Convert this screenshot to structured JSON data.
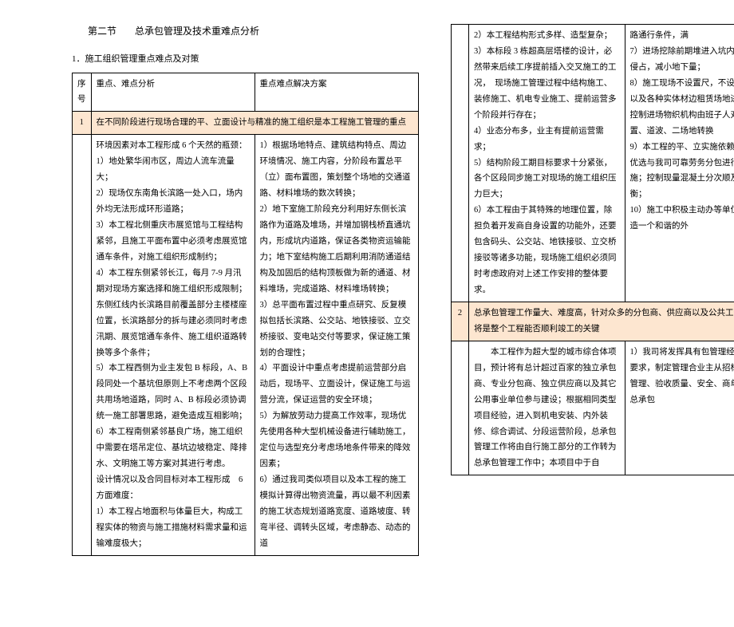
{
  "section": {
    "label": "第二节",
    "title": "总承包管理及技术重难点分析"
  },
  "subsection1": "1．施工组织管理重点难点及对策",
  "table": {
    "headers": {
      "num": "序号",
      "col1": "重点、难点分析",
      "col2": "重点难点解决方案"
    },
    "row1": {
      "num": "1",
      "span_text": "在不同阶段进行现场合理的平、立面设计与精准的施工组织是本工程施工管理的重点"
    },
    "row1_content": {
      "left_intro": "环境因素对本工程形成 6 个天然的瓶颈：",
      "left_items": [
        "1）地处繁华闹市区，周边人流车流量大；",
        "2）现场仅东南角长滨路一处入口，场内外均无法形成环形道路；",
        "3）本工程北侧重庆市展览馆与工程结构紧邻，且施工平面布置中必须考虑展览馆通车条件，对施工组织形成制约；",
        "4）本工程东侧紧邻长江，每月 7-9 月汛期对现场方案选择和施工组织形成限制；东侧红线内长滨路目前覆盖部分主楼楼座位置，长滨路部分的拆与建必须同时考虑汛期、展览馆通车条件、施工组织道路转换等多个条件；",
        "5）本工程西侧为业主发包 B 标段，A、B 段同处一个基坑但原则上不考虑两个区段共用场地道路，同时 A、B 标段必须协调统一施工部署思路，避免造成互相影响；",
        "6）本工程南侧紧邻基良广场，施工组织中需要在塔吊定位、基坑边坡稳定、降排水、文明施工等方案对其进行考虑。"
      ],
      "left_design": "设计情况以及合同目标对本工程形成　6 方面难度：",
      "left_design_items": [
        "1）本工程占地面积与体量巨大，构成工程实体的物资与施工措施材料需求量和运输难度极大；"
      ],
      "right_items": [
        "1）根据场地特点、建筑结构特点、周边环境情况、施工内容，分阶段布置总平（立）面布置图，策划整个场地的交通道路、材料堆场的数次转换；",
        "2）地下室施工阶段充分利用好东侧长滨路作为道路及堆场，并增加钢栈桥直通坑内，形成坑内道路，保证各类物资运输能力；地下室结构施工后期利用消防通道结构及加固后的结构顶板做为新的通道、材料堆场，完成道路、材料堆场转换；",
        "3）总平面布置过程中重点研究、反复模拟包括长滨路、公交站、地铁接驳、立交桥接驳、变电站交付等要求，保证施工策划的合理性；",
        "4）平面设计中重点考虑提前运营部分启动后，现场平、立面设计，保证施工与运营分流，保证运营的安全环境；",
        "5）为解放劳动力提高工作效率，现场优先使用各种大型机械设备进行辅助施工，定位与选型充分考虑场地条件带来的降效因素；",
        "6）通过我司类似项目以及本工程的施工模拟计算得出物资流量，再以最不利因素的施工状态规划道路宽度、道路坡度、转弯半径、调转头区域，考虑静态、动态的道"
      ]
    },
    "page2_left_items": [
      "2）本工程结构形式多样、造型复杂；",
      "3）本标段 3 栋超高层塔楼的设计，必然带来后续工序提前插入交叉施工的工况，　现场施工管理过程中结构施工、装修施工、机电专业施工、提前运营多个阶段并行存在；",
      "4）业态分布多，业主有提前运营需求；",
      "5）结构阶段工期目标要求十分紧张，各个区段同步施工对现场的施工组织压力巨大；",
      "6）本工程由于其特殊的地理位置，除担负着开发商自身设置的功能外，还要包含码头、公交站、地铁接驳、立交桥接驳等诸多功能，现场施工组织必须同时考虑政府对上述工作安排的整体要求。"
    ],
    "page2_right_items": [
      "路通行条件，满",
      "7）进场挖除前期堆进入坑内，避免侵占，减小地下量；",
      "8）施工现场不设置尺，不设置大型以及各种实体材边租赁场地进行严格控制进场物织机构由班子人对场地设置、道波、二场地转换",
      "9）本工程的平、立实施依赖于施工优选与我司可靠劳务分包进行配的实施；控制现量混凝土分次顺及运输均衡；",
      "10）施工中积极主动办等单位联系，造一个和谐的外"
    ],
    "row2": {
      "num": "2",
      "span_text": "总承包管理工作量大、难度高，针对众多的分包商、供应商以及公共工作质量将是整个工程能否顺利竣工的关键"
    },
    "row2_content": {
      "left": "　　本工程作为超大型的城市综合体项目，预计将有总计超过百家的独立承包商、专业分包商、独立供应商以及其它公用事业单位参与建设；根据相同类型项目经验，进入到机电安装、内外装修、综合调试、分段运营阶段，总承包管理工作将由自行施工部分的工作转为总承包管理工作中；本项目中于自",
      "right": "1）我司将发挥具有包管理经验的优要求，制定管理合业主从招标采配合管理、验收质量、安全、商单位行使总承包"
    }
  }
}
